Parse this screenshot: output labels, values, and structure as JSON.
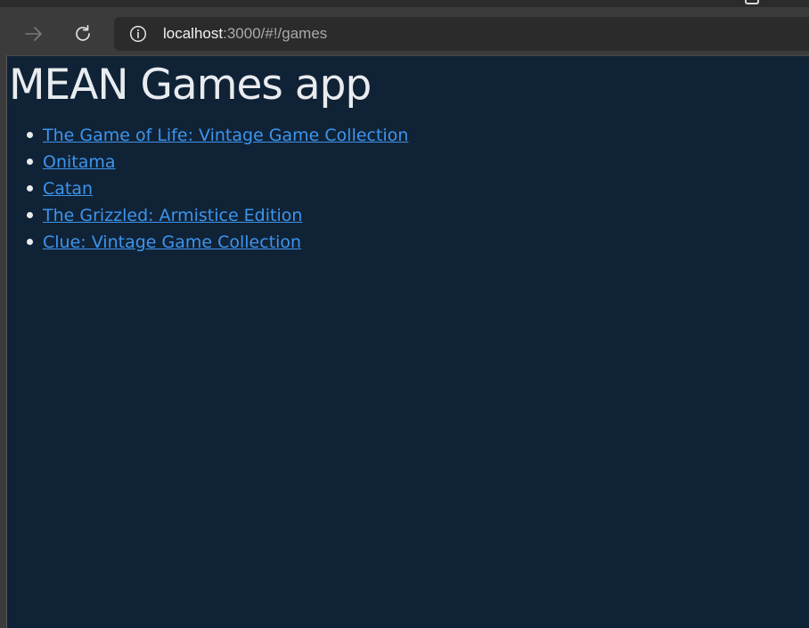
{
  "browser": {
    "url_host": "localhost",
    "url_rest": ":3000/#!/games",
    "icons": {
      "forward": "arrow-right-icon",
      "reload": "reload-icon",
      "info": "info-icon"
    }
  },
  "page": {
    "title": "MEAN Games app",
    "games": [
      {
        "label": "The Game of Life: Vintage Game Collection"
      },
      {
        "label": "Onitama"
      },
      {
        "label": "Catan"
      },
      {
        "label": "The Grizzled: Armistice Edition"
      },
      {
        "label": "Clue: Vintage Game Collection"
      }
    ]
  },
  "colors": {
    "page_background": "#102236",
    "link": "#3d95ec",
    "title": "#e9ecef",
    "browser_chrome": "#3b3b3b",
    "address_bar": "#2b2b2b"
  }
}
